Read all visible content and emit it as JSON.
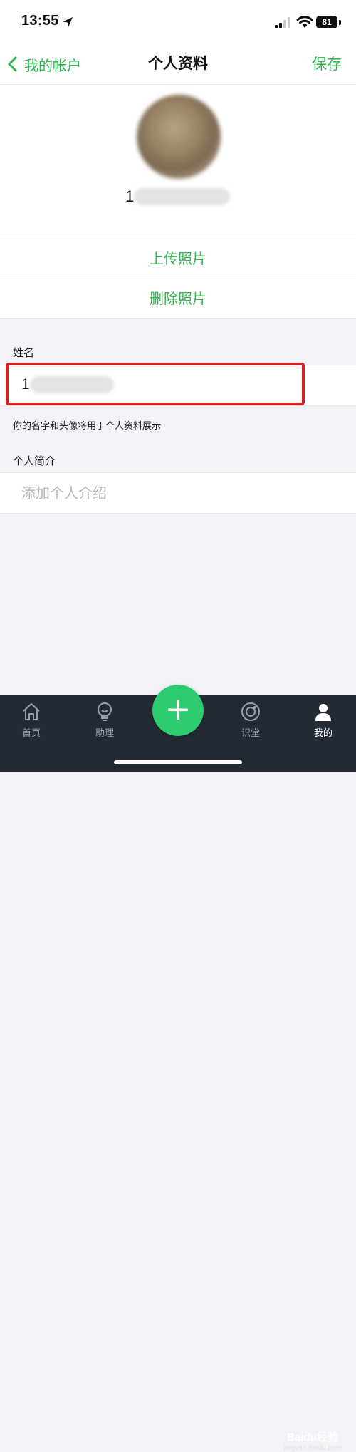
{
  "status_bar": {
    "time": "13:55",
    "battery": "81"
  },
  "nav": {
    "back_label": "我的帐户",
    "title": "个人资料",
    "save_label": "保存"
  },
  "profile": {
    "account_id_visible": "1"
  },
  "actions": {
    "upload_photo": "上传照片",
    "delete_photo": "删除照片"
  },
  "name_section": {
    "label": "姓名",
    "value_visible": "1",
    "hint": "你的名字和头像将用于个人资料展示"
  },
  "bio_section": {
    "label": "个人简介",
    "placeholder": "添加个人介绍",
    "value": ""
  },
  "tab_bar": {
    "tabs": [
      {
        "label": "首页",
        "icon": "home-icon"
      },
      {
        "label": "助理",
        "icon": "lightbulb-icon"
      },
      {
        "label": "识堂",
        "icon": "lens-icon"
      },
      {
        "label": "我的",
        "icon": "person-icon"
      }
    ],
    "fab_icon": "plus-icon",
    "active_tab": "我的"
  },
  "watermark": {
    "brand": "Baidu经验",
    "domain": "jingyan.baidu.com"
  },
  "colors": {
    "accent": "#2fb24f",
    "fab": "#2ecc71",
    "tab_bar_bg": "#242a33",
    "highlight": "#d32020"
  }
}
